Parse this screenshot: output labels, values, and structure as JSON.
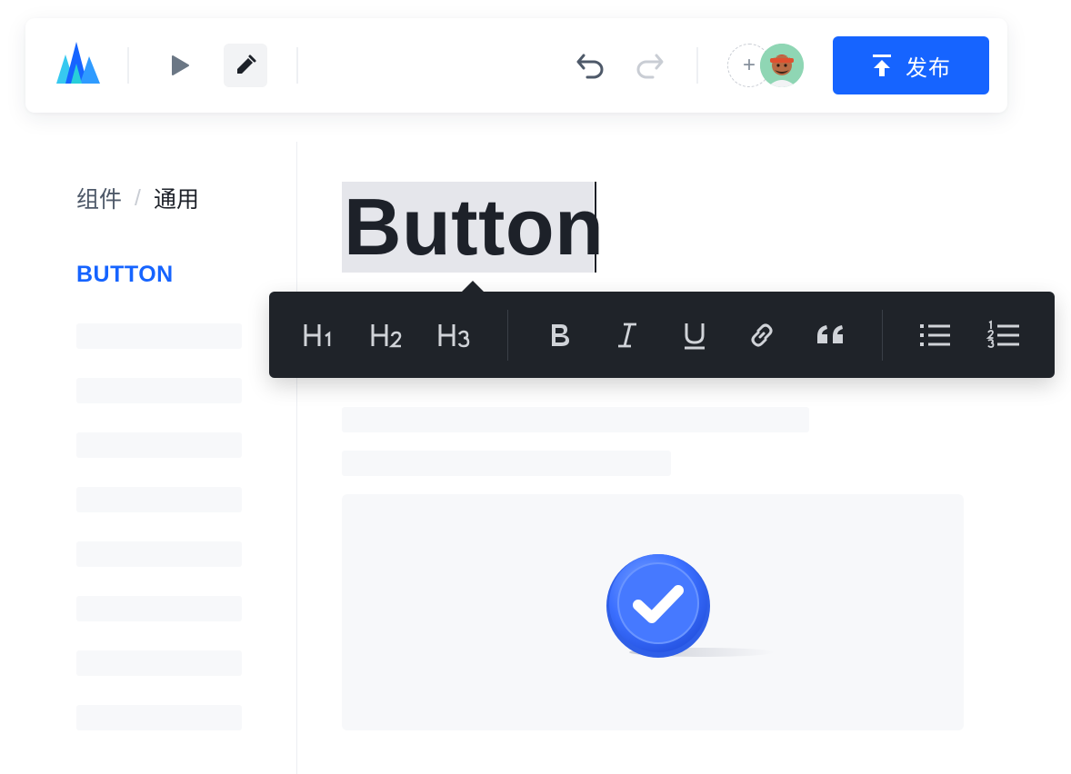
{
  "toolbar": {
    "publish_label": "发布",
    "icons": {
      "logo": "logo-icon",
      "play": "play-icon",
      "edit": "pencil-icon",
      "undo": "undo-icon",
      "redo": "redo-icon",
      "add_collaborator": "plus-icon",
      "publish": "upload-icon"
    },
    "add_symbol": "+"
  },
  "sidebar": {
    "breadcrumb": {
      "parent": "组件",
      "separator": "/",
      "current": "通用"
    },
    "active_item": "BUTTON"
  },
  "editor": {
    "heading": "Button",
    "format_toolbar": {
      "h1": "H1",
      "h2": "H2",
      "h3": "H3",
      "bold": "B",
      "italic": "I",
      "underline": "U",
      "items": [
        "heading-1",
        "heading-2",
        "heading-3",
        "bold",
        "italic",
        "underline",
        "link",
        "quote",
        "bulleted-list",
        "numbered-list"
      ]
    }
  },
  "colors": {
    "accent": "#1664ff",
    "toolbar_bg": "#1f2329",
    "skeleton": "#f7f8fa",
    "selection": "#e5e6eb"
  }
}
